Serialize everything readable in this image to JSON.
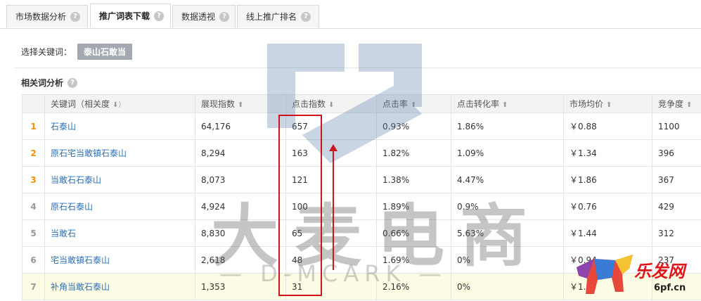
{
  "tabs": [
    {
      "label": "市场数据分析",
      "help": "?"
    },
    {
      "label": "推广词表下载",
      "help": "?"
    },
    {
      "label": "数据透视",
      "help": "?"
    },
    {
      "label": "线上推广排名",
      "help": "?"
    }
  ],
  "keyword_select": {
    "label": "选择关键词：",
    "value": "泰山石敢当"
  },
  "section": {
    "title": "相关词分析",
    "help": "?"
  },
  "table": {
    "headers": [
      {
        "label": "",
        "sort": ""
      },
      {
        "label": "关键词（相关度",
        "sort": "⬇）"
      },
      {
        "label": "展现指数",
        "sort": "⬆"
      },
      {
        "label": "点击指数",
        "sort": "⬇"
      },
      {
        "label": "点击率",
        "sort": "⬆"
      },
      {
        "label": "点击转化率",
        "sort": "⬆"
      },
      {
        "label": "市场均价",
        "sort": "⬆"
      },
      {
        "label": "竞争度",
        "sort": "⬆"
      }
    ],
    "rows": [
      {
        "rank": "1",
        "keyword": "石泰山",
        "show": "64,176",
        "click": "657",
        "ctr": "0.93%",
        "cvr": "1.86%",
        "price": "￥0.88",
        "comp": "1100"
      },
      {
        "rank": "2",
        "keyword": "原石宅当敢镇石泰山",
        "show": "8,294",
        "click": "163",
        "ctr": "1.82%",
        "cvr": "1.09%",
        "price": "￥1.34",
        "comp": "396"
      },
      {
        "rank": "3",
        "keyword": "当敢石石泰山",
        "show": "8,073",
        "click": "121",
        "ctr": "1.38%",
        "cvr": "4.47%",
        "price": "￥1.86",
        "comp": "367"
      },
      {
        "rank": "4",
        "keyword": "原石石泰山",
        "show": "4,924",
        "click": "100",
        "ctr": "1.89%",
        "cvr": "0.9%",
        "price": "￥0.76",
        "comp": "429"
      },
      {
        "rank": "5",
        "keyword": "当敢石",
        "show": "8,830",
        "click": "65",
        "ctr": "0.66%",
        "cvr": "5.63%",
        "price": "￥1.44",
        "comp": "312"
      },
      {
        "rank": "6",
        "keyword": "宅当敢镇石泰山",
        "show": "2,618",
        "click": "48",
        "ctr": "1.69%",
        "cvr": "0%",
        "price": "￥0.94",
        "comp": "237"
      },
      {
        "rank": "7",
        "keyword": "补角当敢石泰山",
        "show": "1,353",
        "click": "31",
        "ctr": "2.16%",
        "cvr": "0%",
        "price": "￥1.",
        "comp": ""
      }
    ]
  },
  "rank_colors": [
    "#f0900a",
    "#f0900a",
    "#f0900a",
    "#999999",
    "#999999",
    "#999999",
    "#999999"
  ],
  "watermark": {
    "main": "大麦电商",
    "sub": "— D-MCARK —"
  },
  "brand": {
    "name": "乐发网",
    "url": "6pf.cn"
  }
}
